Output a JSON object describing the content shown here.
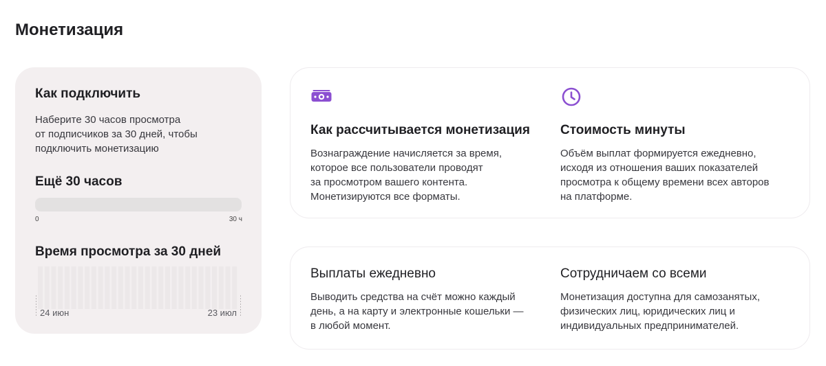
{
  "page": {
    "title": "Монетизация"
  },
  "connect": {
    "title": "Как подключить",
    "description_lines": [
      "Наберите 30 часов просмотра",
      "от подписчиков за 30 дней, чтобы",
      "подключить монетизацию"
    ],
    "remaining_label": "Ещё 30 часов",
    "progress": {
      "min_label": "0",
      "max_label": "30 ч",
      "value_fraction": 0
    },
    "watch_title": "Время просмотра за 30 дней",
    "chart": {
      "start_label": "24 июн",
      "end_label": "23 июл",
      "bar_count": 30
    }
  },
  "info_top": [
    {
      "icon": "money-icon",
      "title": "Как рассчитывается монетизация",
      "text_lines": [
        "Вознаграждение начисляется за время,",
        "которое все пользователи проводят",
        "за просмотром вашего контента.",
        "Монетизируются все форматы."
      ]
    },
    {
      "icon": "clock-icon",
      "title": "Стоимость минуты",
      "text_lines": [
        "Объём выплат формируется ежедневно,",
        "исходя из отношения ваших показателей",
        "просмотра к общему времени всех авторов",
        "на платформе."
      ]
    }
  ],
  "info_bottom": [
    {
      "title": "Выплаты ежедневно",
      "text_lines": [
        "Выводить средства на счёт можно каждый",
        "день, а на карту и электронные кошельки —",
        "в любой момент."
      ]
    },
    {
      "title": "Сотрудничаем со всеми",
      "text_lines": [
        "Монетизация доступна для самозанятых,",
        "физических лиц, юридических лиц и",
        "индивидуальных предпринимателей."
      ]
    }
  ],
  "colors": {
    "accent": "#8b4fd1",
    "card_bg": "#f3eff0",
    "track": "#e3e1e1"
  }
}
